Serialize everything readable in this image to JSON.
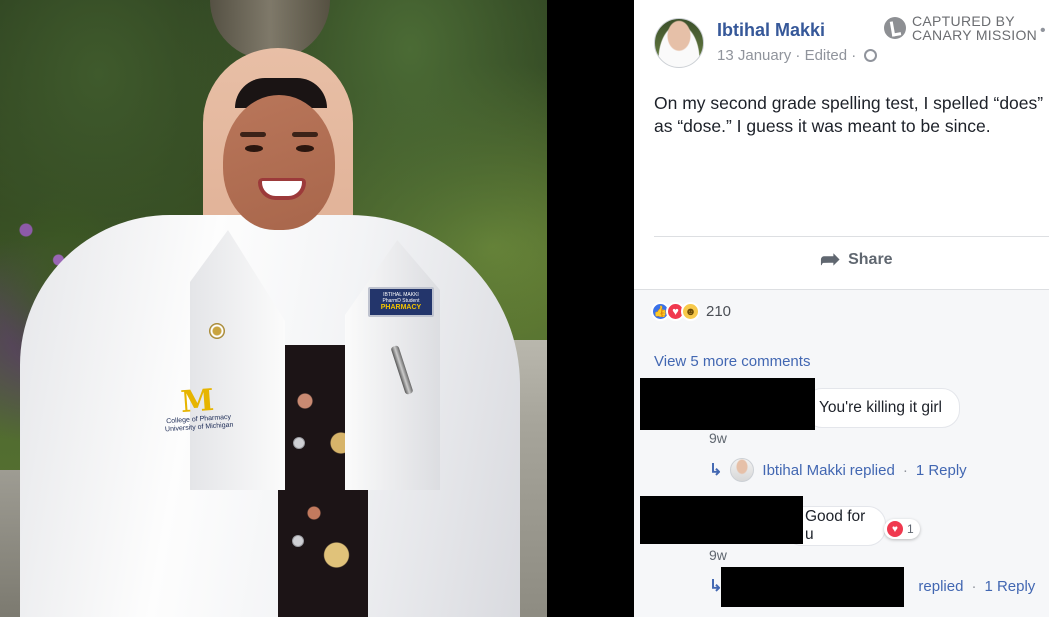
{
  "post": {
    "author": "Ibtihal Makki",
    "date": "13 January",
    "edited": "Edited",
    "separator": "·",
    "text": "On my second grade spelling test, I spelled “does” as “dose.” I guess it was meant to be since.",
    "share_label": "Share",
    "reaction_count": "210",
    "reactions": [
      "like-icon",
      "love-icon",
      "haha-icon"
    ]
  },
  "watermark": {
    "line1": "CAPTURED BY",
    "line2": "CANARY MISSION"
  },
  "badge": {
    "name": "IBTIHAL MAKKI",
    "role": "PharmD Student",
    "org": "PHARMACY"
  },
  "coat_logo": {
    "mark": "M",
    "line1": "College of Pharmacy",
    "line2": "University of Michigan"
  },
  "comments": {
    "view_more": "View 5 more comments",
    "items": [
      {
        "text": "You're killing it girl",
        "time": "9w",
        "reply": {
          "name": "Ibtihal Makki",
          "action": "replied",
          "separator": "·",
          "count_label": "1 Reply"
        }
      },
      {
        "text": "Good for u",
        "time": "9w",
        "reaction_count": "1",
        "reply": {
          "action": "replied",
          "separator": "·",
          "count_label": "1 Reply"
        }
      }
    ]
  },
  "colors": {
    "link": "#365899",
    "meta": "#90949c",
    "panel_bg": "#ffffff",
    "comments_bg": "#f6f7f9"
  }
}
